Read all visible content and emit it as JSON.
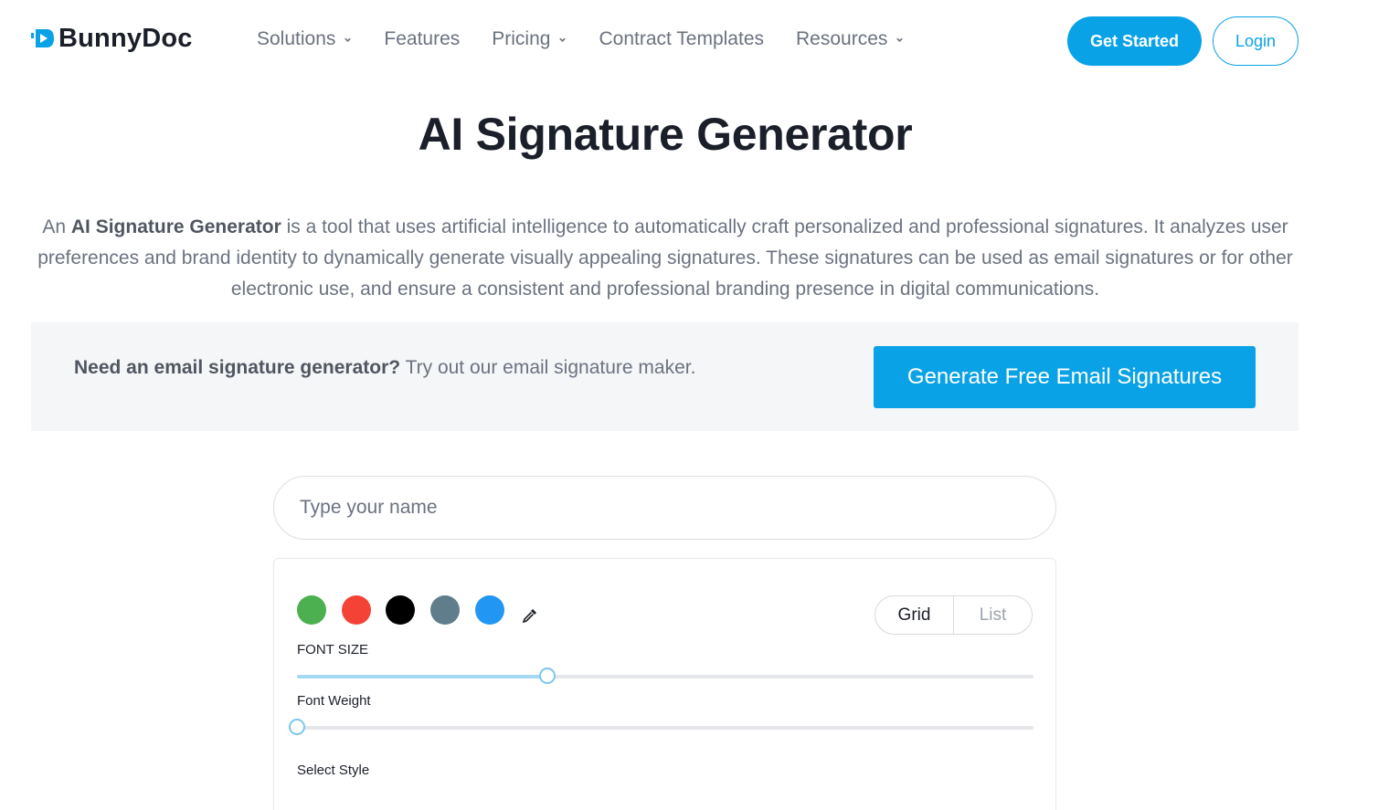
{
  "brand": {
    "name": "BunnyDoc",
    "accent": "#0aa2e6"
  },
  "nav": {
    "items": [
      {
        "label": "Solutions",
        "has_dropdown": true
      },
      {
        "label": "Features",
        "has_dropdown": false
      },
      {
        "label": "Pricing",
        "has_dropdown": true
      },
      {
        "label": "Contract Templates",
        "has_dropdown": false
      },
      {
        "label": "Resources",
        "has_dropdown": true
      }
    ],
    "get_started": "Get Started",
    "login": "Login"
  },
  "main": {
    "title": "AI Signature Generator",
    "intro_prefix": "An ",
    "intro_bold": "AI Signature Generator",
    "intro_rest": " is a tool that uses artificial intelligence to automatically craft personalized and professional signatures. It analyzes user preferences and brand identity to dynamically generate visually appealing signatures. These signatures can be used as email signatures or for other electronic use, and ensure a consistent and professional branding presence in digital communications."
  },
  "promo": {
    "bold": "Need an email signature generator?",
    "text": " Try out our email signature maker.",
    "button": "Generate Free Email Signatures"
  },
  "editor": {
    "name_placeholder": "Type your name",
    "colors": [
      "#4caf50",
      "#f44336",
      "#000000",
      "#607d8b",
      "#2196f3"
    ],
    "picker_icon": "eyedropper-icon",
    "view_options": [
      "Grid",
      "List"
    ],
    "selected_view": "Grid",
    "font_size_label": "FONT SIZE",
    "font_size_level": 0.34,
    "font_weight_label": "Font Weight",
    "font_weight_level": 0.0,
    "style_label": "Select Style"
  }
}
